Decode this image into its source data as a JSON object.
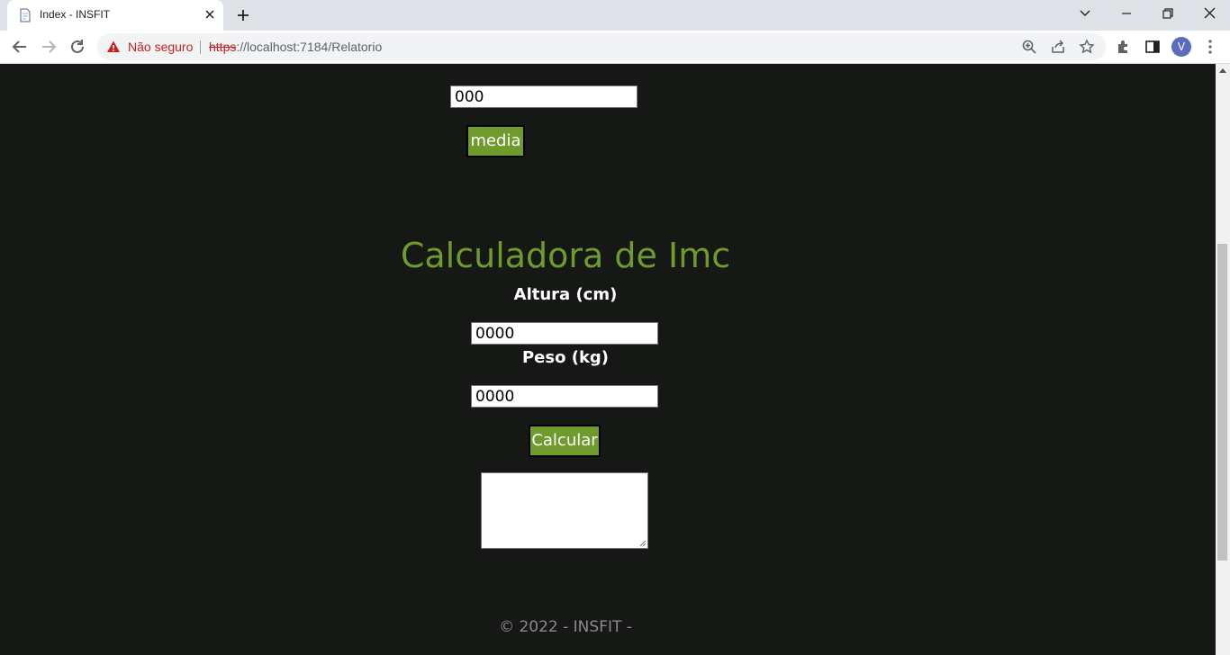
{
  "browser": {
    "tab_title": "Index - INSFIT",
    "security_label": "Não seguro",
    "url_scheme": "https",
    "url_rest": "://localhost:7184/Relatorio",
    "profile_initial": "V"
  },
  "page": {
    "top_input_value": "000",
    "media_button": "media",
    "imc_title": "Calculadora de Imc",
    "altura_label": "Altura (cm)",
    "altura_value": "0000",
    "peso_label": "Peso (kg)",
    "peso_value": "0000",
    "calcular_button": "Calcular",
    "footer": "© 2022 - INSFIT -"
  },
  "colors": {
    "page_background": "#161816",
    "accent_green": "#6f9b2c",
    "insecure_red": "#c5221f"
  }
}
